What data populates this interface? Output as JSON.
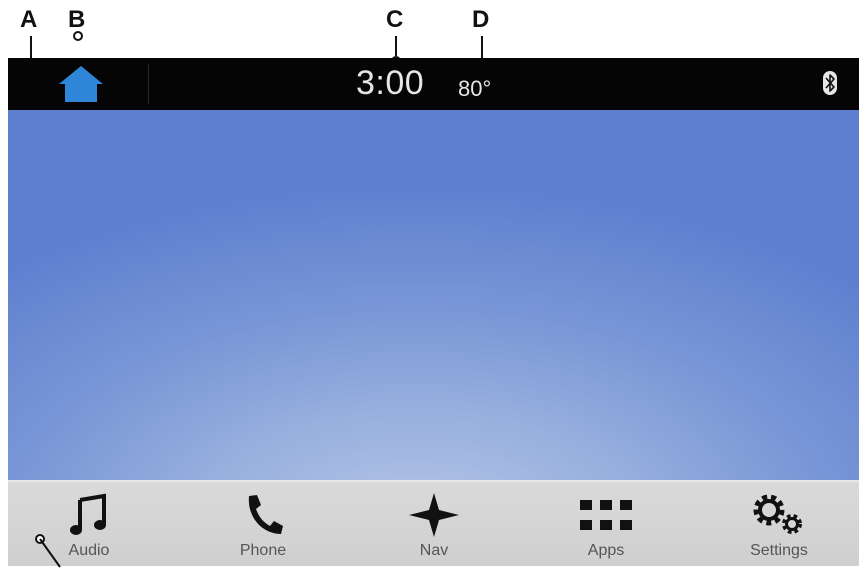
{
  "callouts": {
    "a": "A",
    "b": "B",
    "c": "C",
    "d": "D"
  },
  "statusbar": {
    "time": "3:00",
    "temperature": "80°",
    "home_icon": "home-icon",
    "bluetooth_icon": "bluetooth-icon"
  },
  "dock": {
    "items": [
      {
        "label": "Audio",
        "icon": "music-note-icon"
      },
      {
        "label": "Phone",
        "icon": "phone-icon"
      },
      {
        "label": "Nav",
        "icon": "compass-star-icon"
      },
      {
        "label": "Apps",
        "icon": "apps-grid-icon"
      },
      {
        "label": "Settings",
        "icon": "gears-icon"
      }
    ]
  },
  "colors": {
    "home_icon": "#2f86d9",
    "statusbar_bg": "#050505",
    "dock_bg": "#d4d4d4",
    "wallpaper": "#7896d6"
  }
}
